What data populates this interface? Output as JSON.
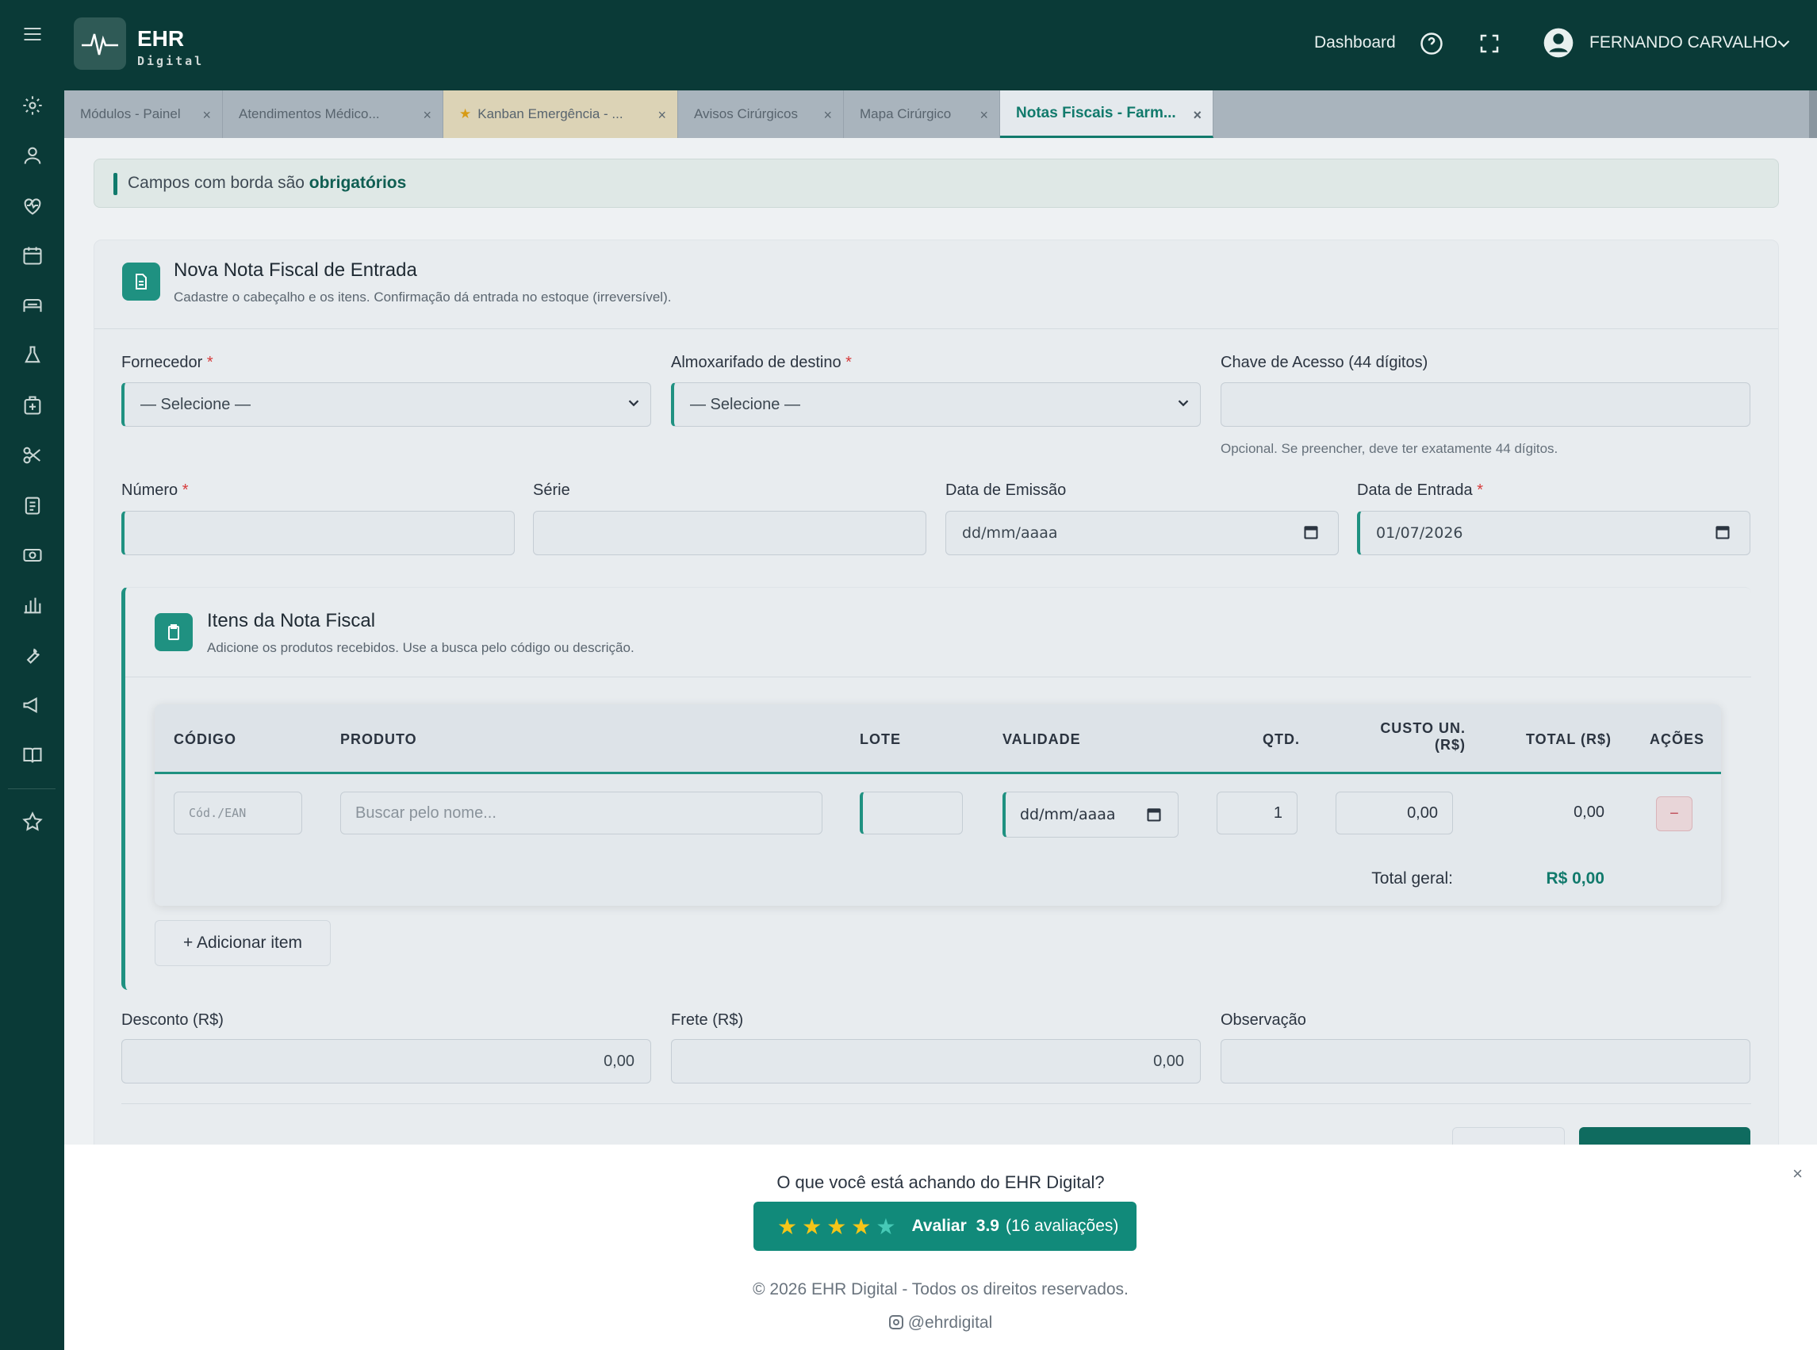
{
  "topbar": {
    "brand": "EHR",
    "brand_sub": "Digital",
    "dashboard_label": "Dashboard",
    "user_name": "FERNANDO CARVALHO"
  },
  "tabs": [
    {
      "label": "Módulos - Painel"
    },
    {
      "label": "Atendimentos Médico..."
    },
    {
      "label": "Kanban Emergência - ..."
    },
    {
      "label": "Avisos Cirúrgicos"
    },
    {
      "label": "Mapa Cirúrgico"
    },
    {
      "label": "Notas Fiscais - Farm..."
    }
  ],
  "notice": {
    "text": "Campos com borda são ",
    "bold": "obrigatórios"
  },
  "form": {
    "title": "Nova Nota Fiscal de Entrada",
    "subtitle": "Cadastre o cabeçalho e os itens. Confirmação dá entrada no estoque (irreversível).",
    "fornecedor_label": "Fornecedor",
    "fornecedor_value": "— Selecione —",
    "almox_label": "Almoxarifado de destino",
    "almox_value": "— Selecione —",
    "chave_label": "Chave de Acesso (44 dígitos)",
    "chave_hint": "Opcional. Se preencher, deve ter exatamente 44 dígitos.",
    "numero_label": "Número",
    "serie_label": "Série",
    "emissao_label": "Data de Emissão",
    "emissao_value": "dd/mm/aaaa",
    "entrada_label": "Data de Entrada",
    "entrada_value": "01/07/2026",
    "required_mark": "*"
  },
  "items": {
    "title": "Itens da Nota Fiscal",
    "subtitle": "Adicione os produtos recebidos. Use a busca pelo código ou descrição.",
    "columns": {
      "codigo": "CÓDIGO",
      "produto": "PRODUTO",
      "lote": "LOTE",
      "validade": "VALIDADE",
      "qtd": "QTD.",
      "custo1": "CUSTO UN.",
      "custo2": "(R$)",
      "total": "TOTAL (R$)",
      "acoes": "AÇÕES"
    },
    "row": {
      "codigo_placeholder": "Cód./EAN",
      "produto_placeholder": "Buscar pelo nome...",
      "validade_value": "dd/mm/aaaa",
      "qtd_value": "1",
      "custo_value": "0,00",
      "total_value": "0,00",
      "remove_label": "−"
    },
    "total_label": "Total geral:",
    "total_value": "R$ 0,00",
    "add_button": "+ Adicionar item"
  },
  "bottom": {
    "desconto_label": "Desconto (R$)",
    "desconto_value": "0,00",
    "frete_label": "Frete (R$)",
    "frete_value": "0,00",
    "obs_label": "Observação"
  },
  "footer": {
    "question": "O que você está achando do EHR Digital?",
    "rate_label": "Avaliar",
    "rating": "3.9",
    "rating_count": "(16 avaliações)",
    "copyright": "© 2026 EHR Digital - Todos os direitos reservados.",
    "instagram": "@ehrdigital",
    "close": "×"
  },
  "colors": {
    "sidebar": "#0a3a37",
    "accent": "#1f9181",
    "required": "#d63b3b"
  }
}
